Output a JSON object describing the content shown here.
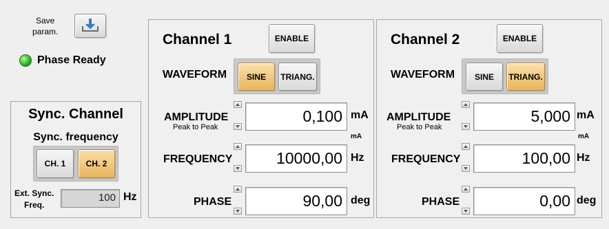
{
  "save": {
    "label": "Save\nparam.",
    "icon": "save-params-icon"
  },
  "status": {
    "label": "Phase Ready",
    "led_color": "#2fb52f",
    "led_state": "on"
  },
  "sync": {
    "title": "Sync. Channel",
    "freq_label": "Sync. frequency",
    "ch1": "CH. 1",
    "ch2": "CH. 2",
    "selected": "CH. 2",
    "ext_label": "Ext. Sync.\nFreq.",
    "ext_value": "100",
    "ext_unit": "Hz"
  },
  "channels": [
    {
      "title": "Channel 1",
      "enable": "ENABLE",
      "waveform_label": "WAVEFORM",
      "sine": "SINE",
      "triang": "TRIANG.",
      "waveform_selected": "SINE",
      "amplitude_label": "AMPLITUDE",
      "amplitude_sub": "Peak to Peak",
      "amplitude_value": "0,100",
      "amplitude_unit": "mA",
      "amplitude_unit_small": "mA",
      "frequency_label": "FREQUENCY",
      "frequency_value": "10000,00",
      "frequency_unit": "Hz",
      "phase_label": "PHASE",
      "phase_value": "90,00",
      "phase_unit": "deg"
    },
    {
      "title": "Channel 2",
      "enable": "ENABLE",
      "waveform_label": "WAVEFORM",
      "sine": "SINE",
      "triang": "TRIANG.",
      "waveform_selected": "TRIANG.",
      "amplitude_label": "AMPLITUDE",
      "amplitude_sub": "Peak to Peak",
      "amplitude_value": "5,000",
      "amplitude_unit": "mA",
      "amplitude_unit_small": "mA",
      "frequency_label": "FREQUENCY",
      "frequency_value": "100,00",
      "frequency_unit": "Hz",
      "phase_label": "PHASE",
      "phase_value": "0,00",
      "phase_unit": "deg"
    }
  ],
  "colors": {
    "selected_button": "#e8b55d",
    "background": "#efefef"
  }
}
